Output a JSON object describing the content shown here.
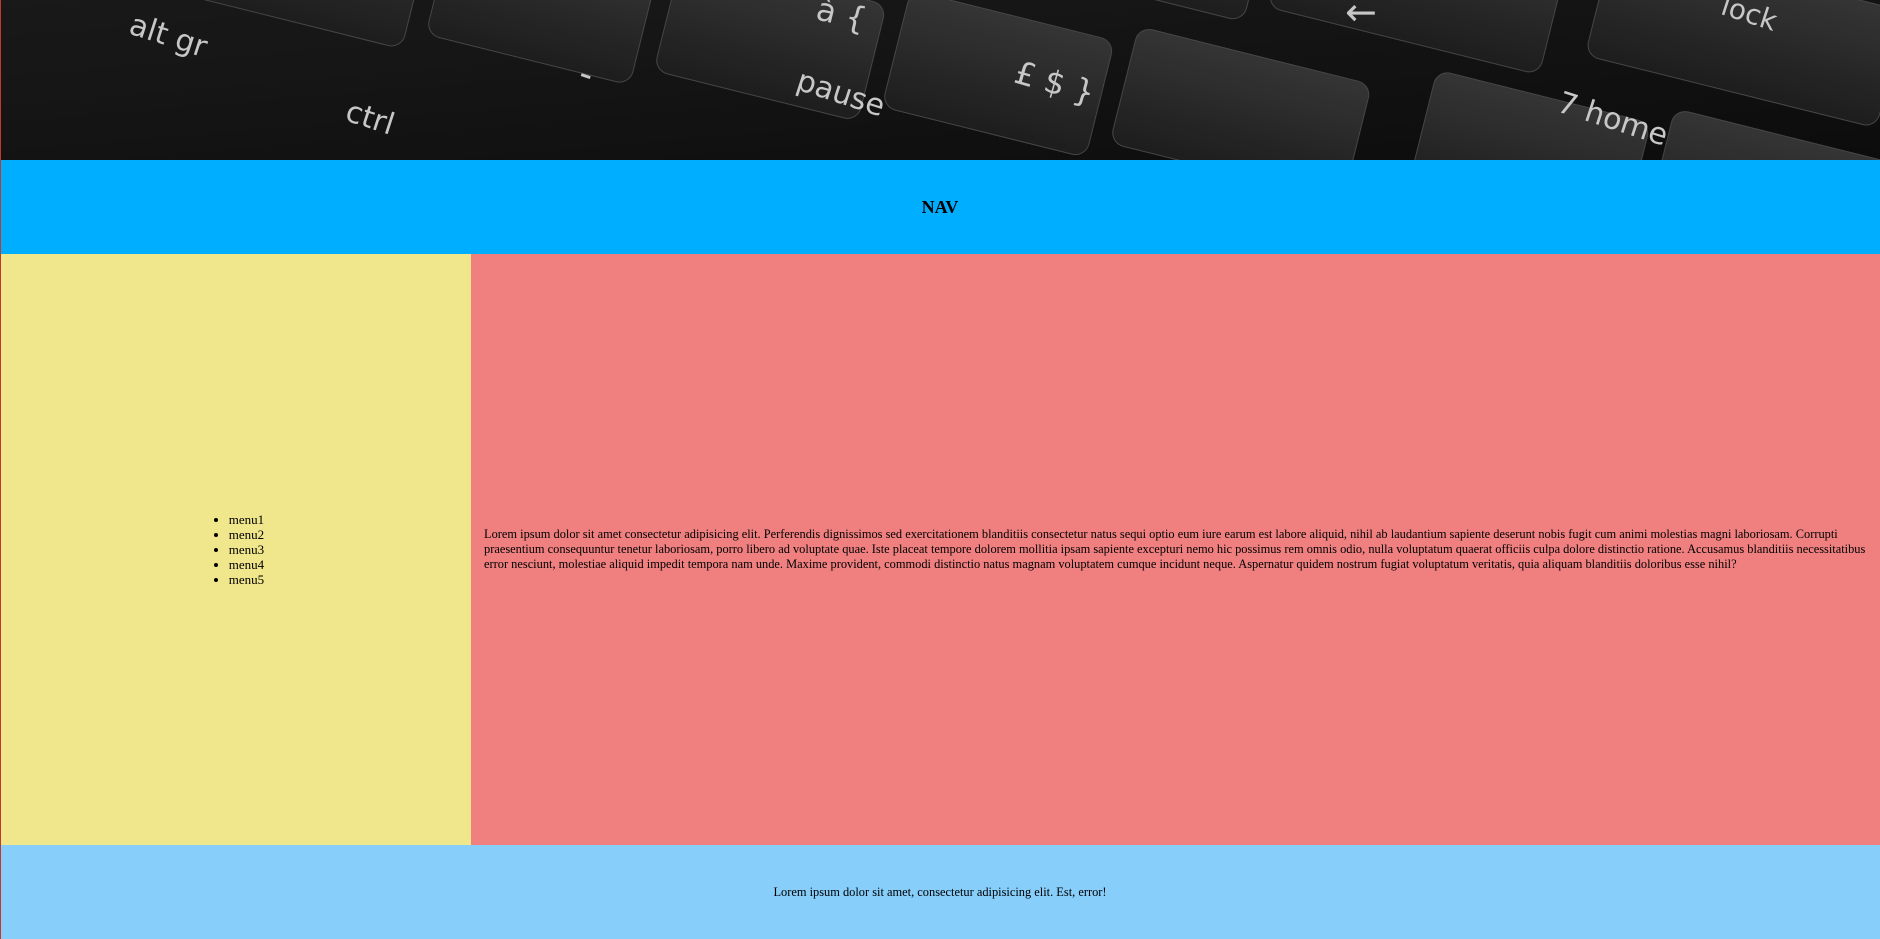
{
  "header": {
    "image_alt": "keyboard-photo",
    "keys": [
      "alt gr",
      "ctrl",
      "-",
      "pause",
      "à {",
      "£ $ }",
      "←",
      "7 home",
      "lock"
    ]
  },
  "nav": {
    "title": "NAV"
  },
  "sidebar": {
    "items": [
      {
        "label": "menu1"
      },
      {
        "label": "menu2"
      },
      {
        "label": "menu3"
      },
      {
        "label": "menu4"
      },
      {
        "label": "menu5"
      }
    ]
  },
  "main": {
    "body_text": "Lorem ipsum dolor sit amet consectetur adipisicing elit. Perferendis dignissimos sed exercitationem blanditiis consectetur natus sequi optio eum iure earum est labore aliquid, nihil ab laudantium sapiente deserunt nobis fugit cum animi molestias magni laboriosam. Corrupti praesentium consequuntur tenetur laboriosam, porro libero ad voluptate quae. Iste placeat tempore dolorem mollitia ipsam sapiente excepturi nemo hic possimus rem omnis odio, nulla voluptatum quaerat officiis culpa dolore distinctio ratione. Accusamus blanditiis necessitatibus error nesciunt, molestiae aliquid impedit tempora nam unde. Maxime provident, commodi distinctio natus magnam voluptatem cumque incidunt neque. Aspernatur quidem nostrum fugiat voluptatum veritatis, quia aliquam blanditiis doloribus esse nihil?"
  },
  "footer": {
    "text": "Lorem ipsum dolor sit amet, consectetur adipisicing elit. Est, error!"
  },
  "colors": {
    "nav": "#00aeff",
    "sidebar": "#f0e68c",
    "main": "#f08080",
    "footer": "#87cefa"
  }
}
